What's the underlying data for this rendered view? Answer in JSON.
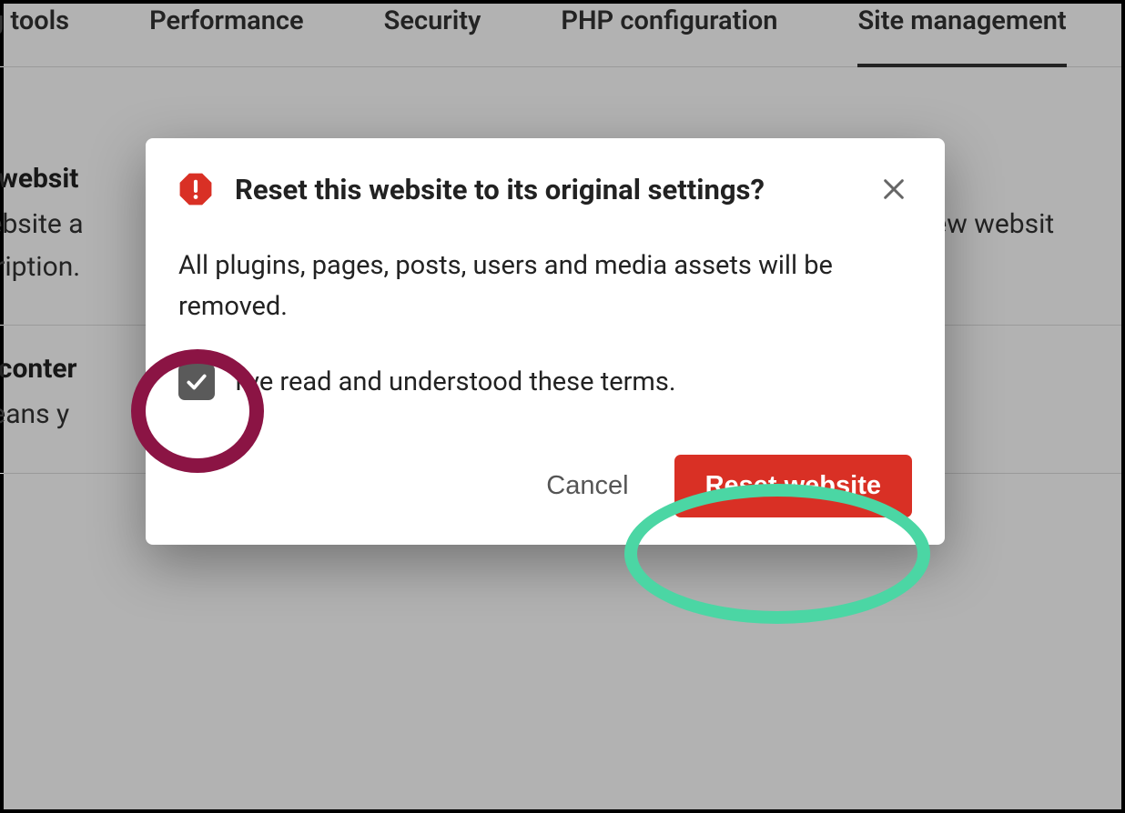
{
  "tabs": {
    "items": [
      {
        "label": "ing tools"
      },
      {
        "label": "Performance"
      },
      {
        "label": "Security"
      },
      {
        "label": "PHP configuration"
      },
      {
        "label": "Site management",
        "active": true
      }
    ]
  },
  "sections": {
    "delete_website": {
      "title": "te websit",
      "desc_line1": "website a",
      "desc_right": "r a new websit",
      "desc_line2": "scription."
    },
    "delete_content": {
      "title": "te conter",
      "desc": "means y"
    }
  },
  "modal": {
    "title": "Reset this website to its original settings?",
    "body": "All plugins, pages, posts, users and media assets will be removed.",
    "checkbox_label": "I've read and understood these terms.",
    "checkbox_checked": true,
    "cancel_label": "Cancel",
    "confirm_label": "Reset website"
  },
  "annotations": {
    "checkbox_highlight_color": "#8b1444",
    "confirm_highlight_color": "#4bd6a4"
  }
}
